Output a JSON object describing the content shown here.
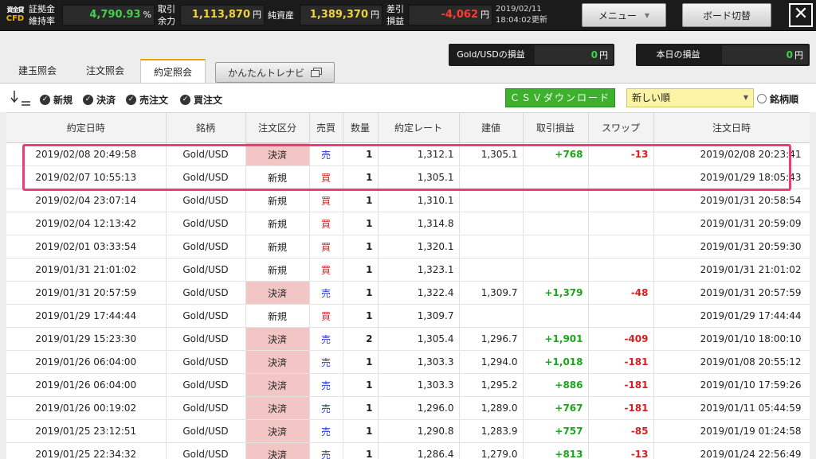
{
  "logo": {
    "line1": "資金貸",
    "line2": "CFD"
  },
  "header": {
    "margin_ratio_label": "証拠金\n維持率",
    "margin_ratio_value": "4,790.93",
    "margin_ratio_unit": "%",
    "available_label": "取引\n余力",
    "available_value": "1,113,870",
    "available_unit": "円",
    "net_assets_label": "純資産",
    "net_assets_value": "1,389,370",
    "net_assets_unit": "円",
    "diff_pl_label": "差引\n損益",
    "diff_pl_value": "-4,062",
    "diff_pl_unit": "円",
    "timestamp_date": "2019/02/11",
    "timestamp_time": "18:04:02更新",
    "menu_label": "メニュー",
    "board_label": "ボード切替",
    "close_label": "✕"
  },
  "pl_summary": {
    "gold_label": "Gold/USDの損益",
    "gold_value": "0",
    "gold_unit": "円",
    "today_label": "本日の損益",
    "today_value": "0",
    "today_unit": "円"
  },
  "tabs": [
    {
      "label": "建玉照会"
    },
    {
      "label": "注文照会"
    },
    {
      "label": "約定照会"
    }
  ],
  "navi_button": "かんたんトレナビ",
  "filters": {
    "new": "新規",
    "settle": "決済",
    "sell_order": "売注文",
    "buy_order": "買注文"
  },
  "csv_button": "ＣＳＶダウンロード",
  "sort_select": "新しい順",
  "symbol_order": "銘柄順",
  "columns": [
    "約定日時",
    "銘柄",
    "注文区分",
    "売買",
    "数量",
    "約定レート",
    "建値",
    "取引損益",
    "スワップ",
    "注文日時"
  ],
  "rows": [
    {
      "date": "2019/02/08 20:49:58",
      "symbol": "Gold/USD",
      "type": "決済",
      "side": "売",
      "qty": "1",
      "rate": "1,312.1",
      "open": "1,305.1",
      "pl": "+768",
      "swap": "-13",
      "order_date": "2019/02/08 20:23:41"
    },
    {
      "date": "2019/02/07 10:55:13",
      "symbol": "Gold/USD",
      "type": "新規",
      "side": "買",
      "qty": "1",
      "rate": "1,305.1",
      "open": "",
      "pl": "",
      "swap": "",
      "order_date": "2019/01/29 18:05:43"
    },
    {
      "date": "2019/02/04 23:07:14",
      "symbol": "Gold/USD",
      "type": "新規",
      "side": "買",
      "qty": "1",
      "rate": "1,310.1",
      "open": "",
      "pl": "",
      "swap": "",
      "order_date": "2019/01/31 20:58:54"
    },
    {
      "date": "2019/02/04 12:13:42",
      "symbol": "Gold/USD",
      "type": "新規",
      "side": "買",
      "qty": "1",
      "rate": "1,314.8",
      "open": "",
      "pl": "",
      "swap": "",
      "order_date": "2019/01/31 20:59:09"
    },
    {
      "date": "2019/02/01 03:33:54",
      "symbol": "Gold/USD",
      "type": "新規",
      "side": "買",
      "qty": "1",
      "rate": "1,320.1",
      "open": "",
      "pl": "",
      "swap": "",
      "order_date": "2019/01/31 20:59:30"
    },
    {
      "date": "2019/01/31 21:01:02",
      "symbol": "Gold/USD",
      "type": "新規",
      "side": "買",
      "qty": "1",
      "rate": "1,323.1",
      "open": "",
      "pl": "",
      "swap": "",
      "order_date": "2019/01/31 21:01:02"
    },
    {
      "date": "2019/01/31 20:57:59",
      "symbol": "Gold/USD",
      "type": "決済",
      "side": "売",
      "qty": "1",
      "rate": "1,322.4",
      "open": "1,309.7",
      "pl": "+1,379",
      "swap": "-48",
      "order_date": "2019/01/31 20:57:59"
    },
    {
      "date": "2019/01/29 17:44:44",
      "symbol": "Gold/USD",
      "type": "新規",
      "side": "買",
      "qty": "1",
      "rate": "1,309.7",
      "open": "",
      "pl": "",
      "swap": "",
      "order_date": "2019/01/29 17:44:44"
    },
    {
      "date": "2019/01/29 15:23:30",
      "symbol": "Gold/USD",
      "type": "決済",
      "side": "売",
      "qty": "2",
      "rate": "1,305.4",
      "open": "1,296.7",
      "pl": "+1,901",
      "swap": "-409",
      "order_date": "2019/01/10 18:00:10"
    },
    {
      "date": "2019/01/26 06:04:00",
      "symbol": "Gold/USD",
      "type": "決済",
      "side": "売",
      "qty": "1",
      "rate": "1,303.3",
      "open": "1,294.0",
      "pl": "+1,018",
      "swap": "-181",
      "order_date": "2019/01/08 20:55:12"
    },
    {
      "date": "2019/01/26 06:04:00",
      "symbol": "Gold/USD",
      "type": "決済",
      "side": "売",
      "qty": "1",
      "rate": "1,303.3",
      "open": "1,295.2",
      "pl": "+886",
      "swap": "-181",
      "order_date": "2019/01/10 17:59:26"
    },
    {
      "date": "2019/01/26 00:19:02",
      "symbol": "Gold/USD",
      "type": "決済",
      "side": "売",
      "qty": "1",
      "rate": "1,296.0",
      "open": "1,289.0",
      "pl": "+767",
      "swap": "-181",
      "order_date": "2019/01/11 05:44:59"
    },
    {
      "date": "2019/01/25 23:12:51",
      "symbol": "Gold/USD",
      "type": "決済",
      "side": "売",
      "qty": "1",
      "rate": "1,290.8",
      "open": "1,283.9",
      "pl": "+757",
      "swap": "-85",
      "order_date": "2019/01/19 01:24:58"
    },
    {
      "date": "2019/01/25 22:34:32",
      "symbol": "Gold/USD",
      "type": "決済",
      "side": "売",
      "qty": "1",
      "rate": "1,286.4",
      "open": "1,279.0",
      "pl": "+813",
      "swap": "-13",
      "order_date": "2019/01/24 22:56:49"
    }
  ],
  "colors": {
    "accent_green": "#3fd24a",
    "accent_yellow": "#f0d23a",
    "settle_bg": "#f3c6c6",
    "sell_blue": "#2b3cc7",
    "buy_red": "#d32a2a",
    "highlight": "#ee3b7c"
  }
}
